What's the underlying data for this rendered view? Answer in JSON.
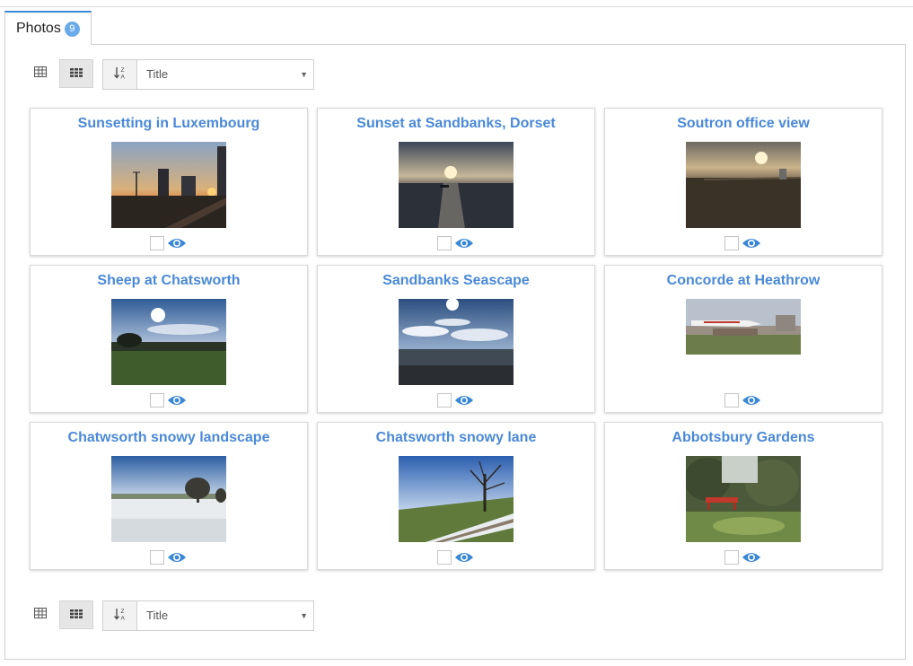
{
  "tab": {
    "label": "Photos",
    "count": "9"
  },
  "toolbar": {
    "sort_field": "Title"
  },
  "colors": {
    "accent": "#4a89d8",
    "badge": "#6aaae9",
    "eye": "#3a87d6"
  },
  "photos": [
    {
      "title": "Sunsetting in Luxembourg"
    },
    {
      "title": "Sunset at Sandbanks, Dorset"
    },
    {
      "title": "Soutron office view"
    },
    {
      "title": "Sheep at Chatsworth"
    },
    {
      "title": "Sandbanks Seascape"
    },
    {
      "title": "Concorde at Heathrow"
    },
    {
      "title": "Chatwsorth snowy landscape"
    },
    {
      "title": "Chatsworth snowy lane"
    },
    {
      "title": "Abbotsbury Gardens"
    }
  ]
}
